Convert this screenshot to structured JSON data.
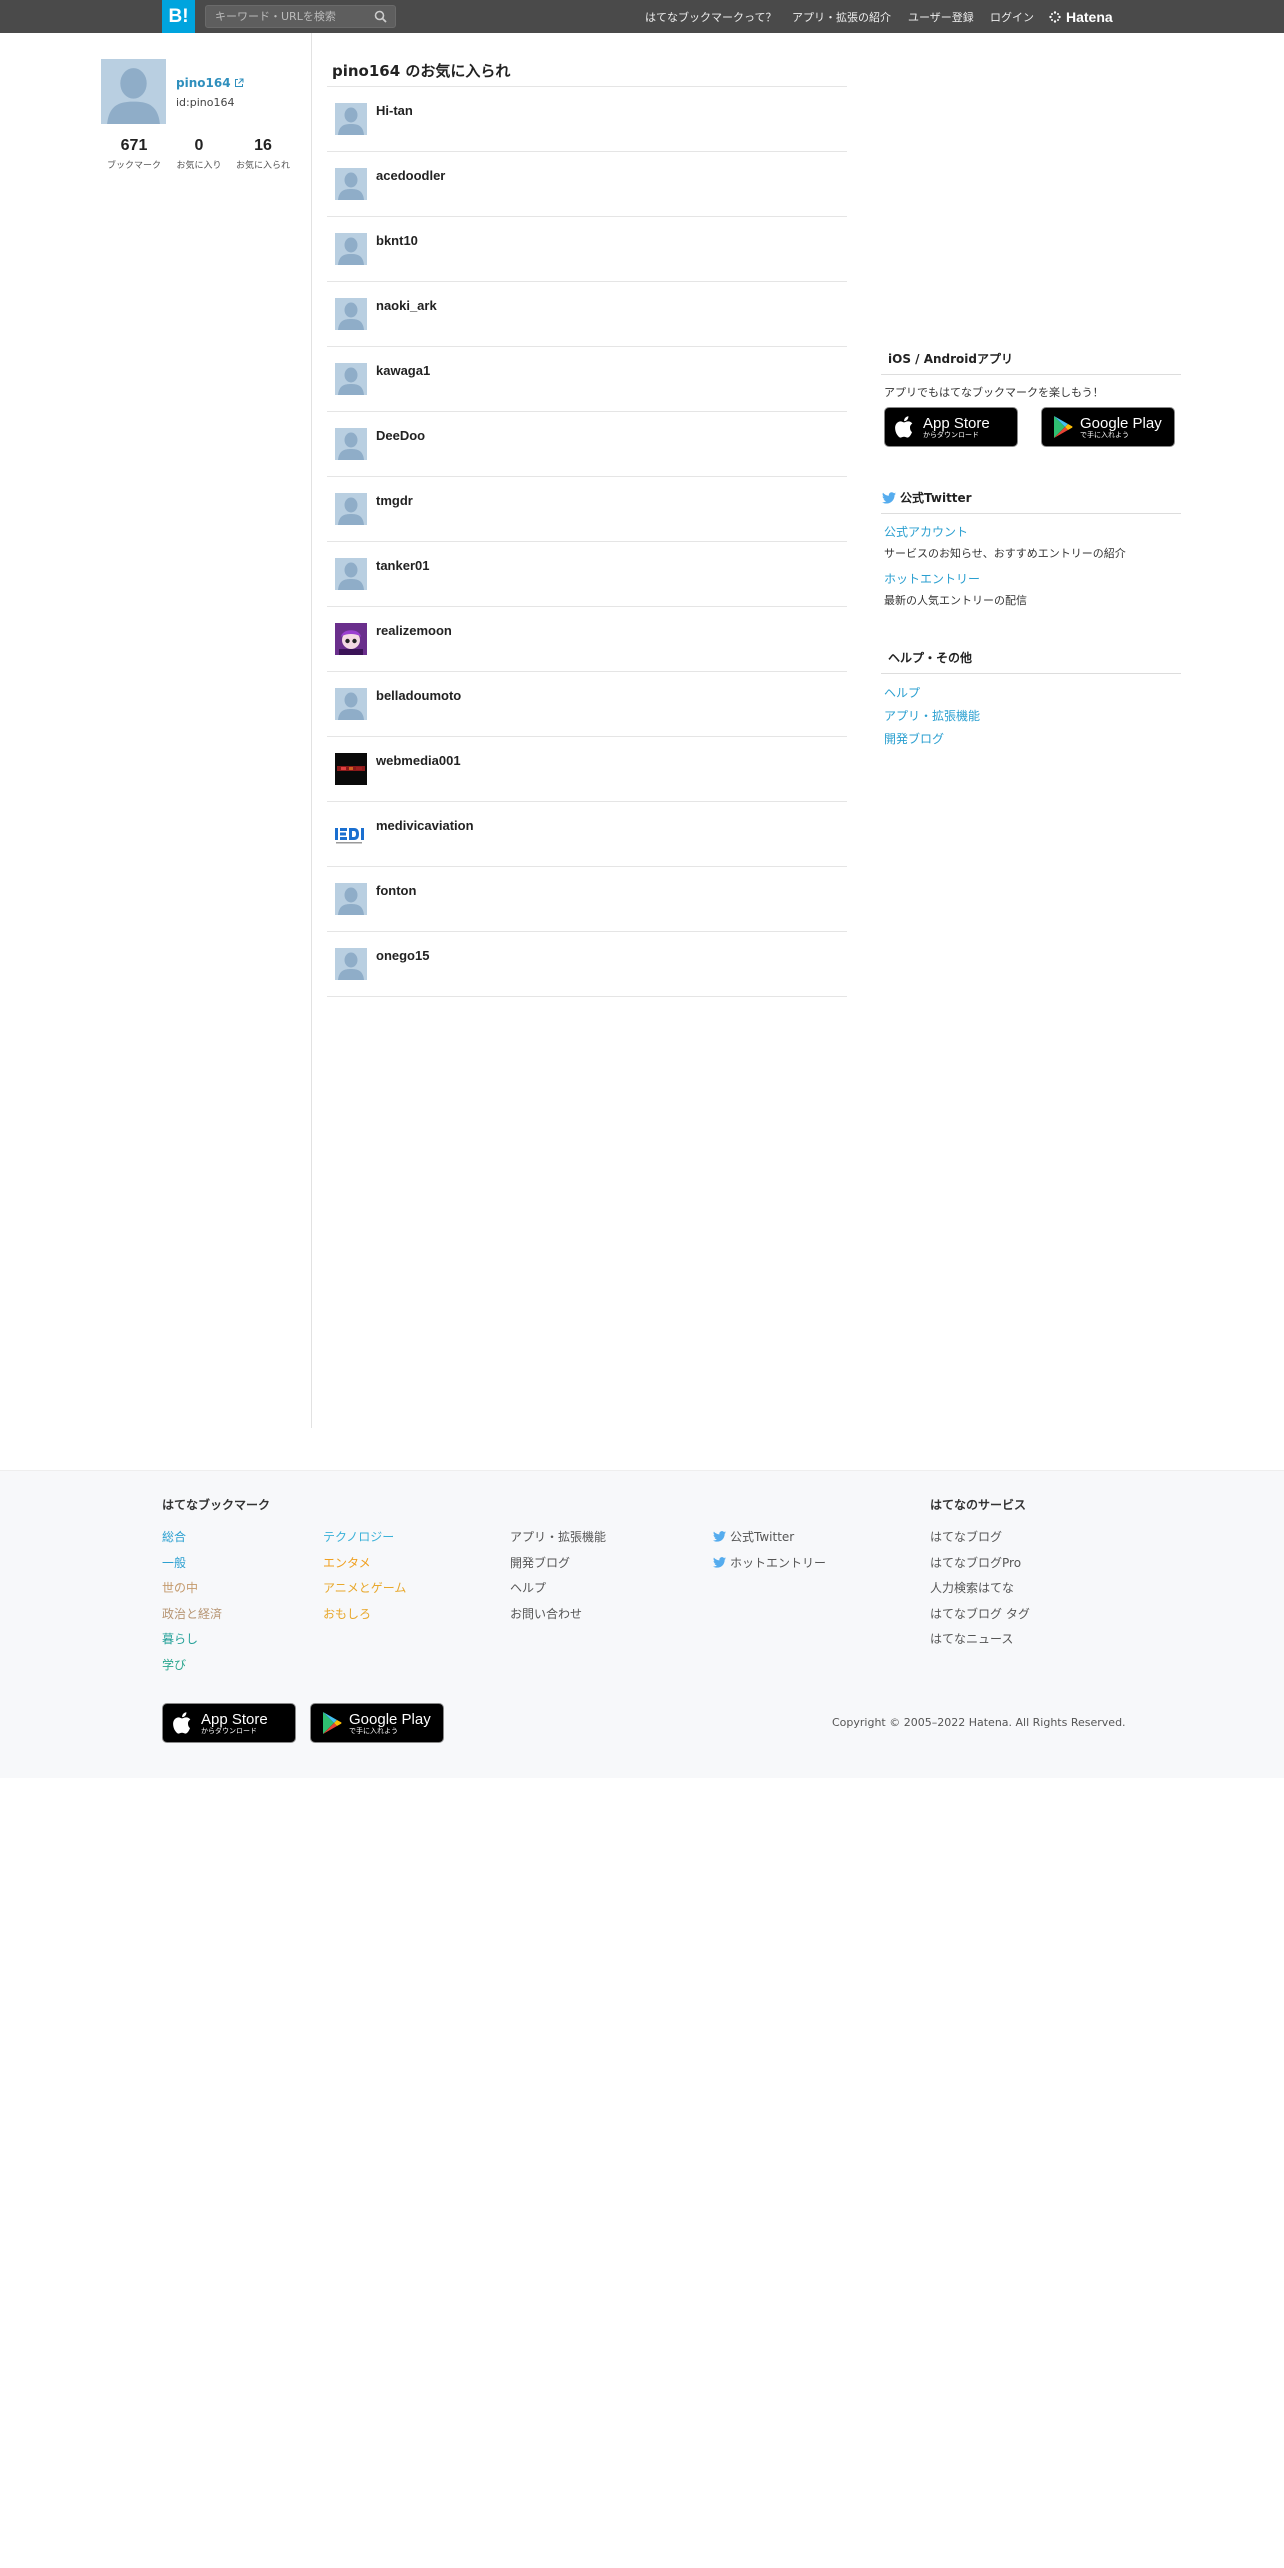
{
  "header": {
    "logo": "B!",
    "search_placeholder": "キーワード・URLを検索",
    "nav": [
      "はてなブックマークって？",
      "アプリ・拡張の紹介",
      "ユーザー登録",
      "ログイン"
    ],
    "brand": "Hatena"
  },
  "profile": {
    "name": "pino164",
    "id_text": "id:pino164",
    "stats": [
      {
        "value": "671",
        "label": "ブックマーク"
      },
      {
        "value": "0",
        "label": "お気に入り"
      },
      {
        "value": "16",
        "label": "お気に入られ"
      }
    ]
  },
  "main": {
    "title": "pino164 のお気に入られ",
    "users": [
      {
        "name": "Hi-tan",
        "avatar": "default"
      },
      {
        "name": "acedoodler",
        "avatar": "default"
      },
      {
        "name": "bknt10",
        "avatar": "default"
      },
      {
        "name": "naoki_ark",
        "avatar": "default"
      },
      {
        "name": "kawaga1",
        "avatar": "default"
      },
      {
        "name": "DeeDoo",
        "avatar": "default"
      },
      {
        "name": "tmgdr",
        "avatar": "default"
      },
      {
        "name": "tanker01",
        "avatar": "default"
      },
      {
        "name": "realizemoon",
        "avatar": "anime"
      },
      {
        "name": "belladoumoto",
        "avatar": "default"
      },
      {
        "name": "webmedia001",
        "avatar": "dark"
      },
      {
        "name": "medivicaviation",
        "avatar": "logo"
      },
      {
        "name": "fonton",
        "avatar": "default"
      },
      {
        "name": "onego15",
        "avatar": "default"
      }
    ]
  },
  "sidebar": {
    "apps": {
      "title": "iOS / Androidアプリ",
      "text": "アプリでもはてなブックマークを楽しもう！",
      "appstore": {
        "line1": "App Store",
        "line2": "からダウンロード"
      },
      "googleplay": {
        "line1": "Google Play",
        "line2": "で手に入れよう"
      }
    },
    "twitter": {
      "title": "公式Twitter",
      "links": [
        {
          "label": "公式アカウント",
          "desc": "サービスのお知らせ、おすすめエントリーの紹介"
        },
        {
          "label": "ホットエントリー",
          "desc": "最新の人気エントリーの配信"
        }
      ]
    },
    "help": {
      "title": "ヘルプ・その他",
      "links": [
        "ヘルプ",
        "アプリ・拡張機能",
        "開発ブログ"
      ]
    }
  },
  "footer": {
    "bookmark_title": "はてなブックマーク",
    "categories_col1": [
      "総合",
      "一般",
      "世の中",
      "政治と経済",
      "暮らし",
      "学び"
    ],
    "categories_col2": [
      "テクノロジー",
      "エンタメ",
      "アニメとゲーム",
      "おもしろ"
    ],
    "links_col3": [
      "アプリ・拡張機能",
      "開発ブログ",
      "ヘルプ",
      "お問い合わせ"
    ],
    "links_col4": [
      "公式Twitter",
      "ホットエントリー"
    ],
    "services_title": "はてなのサービス",
    "services": [
      "はてなブログ",
      "はてなブログPro",
      "人力検索はてな",
      "はてなブログ タグ",
      "はてなニュース"
    ],
    "copyright": "Copyright © 2005–2022 Hatena. All Rights Reserved.",
    "appstore": {
      "line1": "App Store",
      "line2": "からダウンロード"
    },
    "googleplay": {
      "line1": "Google Play",
      "line2": "で手に入れよう"
    }
  },
  "colors": {
    "topbar": "#4a4a4a",
    "brand_blue": "#00a4de",
    "link_blue": "#2a9fd0",
    "cat_tech": "#3ab1d8",
    "cat_general": "#2a9fd0",
    "cat_world": "#c49a6c",
    "cat_politics": "#b79573",
    "cat_life": "#27a29a",
    "cat_learn": "#2aa58e",
    "cat_ent": "#f0a020",
    "cat_anime": "#e8a82c",
    "cat_fun": "#e8a82c"
  }
}
